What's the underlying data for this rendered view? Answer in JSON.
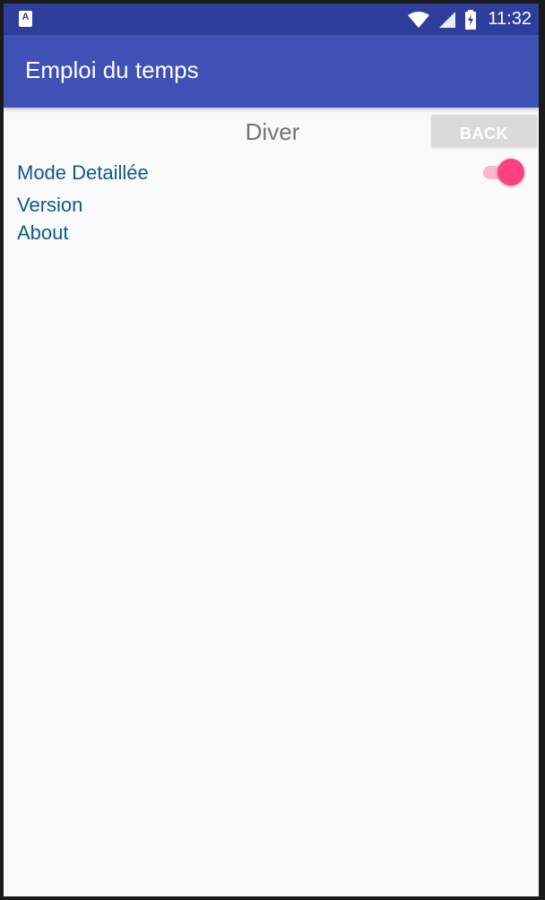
{
  "status_bar": {
    "app_icon": "A",
    "icons": [
      "wifi-icon",
      "cellular-signal-icon",
      "battery-charging-icon"
    ],
    "time": "11:32"
  },
  "app_bar": {
    "title": "Emploi du temps"
  },
  "content": {
    "section_title": "Diver",
    "back_button": "BACK",
    "items": [
      {
        "label": "Mode Detaillée",
        "has_switch": true,
        "switch_on": true
      },
      {
        "label": "Version"
      },
      {
        "label": "About"
      }
    ]
  },
  "colors": {
    "status_bar": "#2d3e9c",
    "app_bar": "#3f51b5",
    "accent": "#ff4081",
    "item_text": "#0e5a8a"
  }
}
